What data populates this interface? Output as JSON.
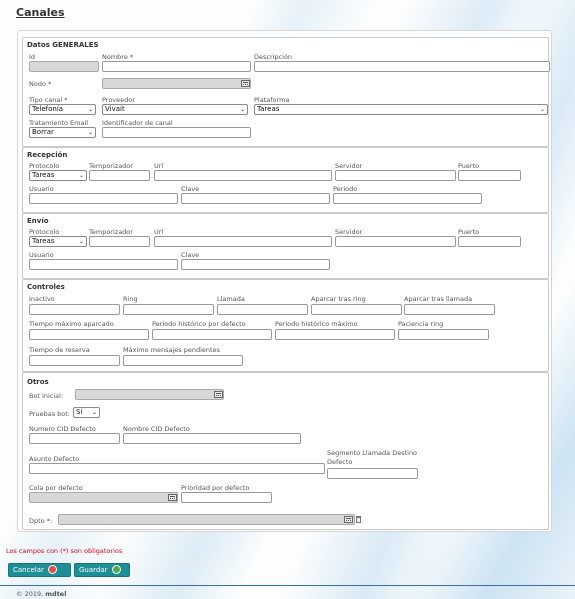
{
  "page": {
    "title": "Canales"
  },
  "generales": {
    "title": "Datos GENERALES",
    "id_label": "Id",
    "nombre_label": "Nombre *",
    "descripcion_label": "Descripción",
    "nodo_label": "Nodo *",
    "tipo_canal_label": "Tipo canal *",
    "tipo_canal_value": "Telefonía",
    "proveedor_label": "Proveedor",
    "proveedor_value": "Vivait",
    "plataforma_label": "Plataforma",
    "plataforma_value": "Tareas",
    "tratamiento_label": "Tratamiento Email",
    "tratamiento_value": "Borrar",
    "identificador_label": "Identificador de canal"
  },
  "recepcion": {
    "title": "Recepción",
    "protocolo_label": "Protocolo",
    "protocolo_value": "Tareas",
    "temporizador_label": "Temporizador",
    "url_label": "Url",
    "servidor_label": "Servidor",
    "puerto_label": "Puerto",
    "usuario_label": "Usuario",
    "clave_label": "Clave",
    "periodo_label": "Periodo"
  },
  "envio": {
    "title": "Envío",
    "protocolo_label": "Protocolo",
    "protocolo_value": "Tareas",
    "temporizador_label": "Temporizador",
    "url_label": "Url",
    "servidor_label": "Servidor",
    "puerto_label": "Puerto",
    "usuario_label": "Usuario",
    "clave_label": "Clave"
  },
  "controles": {
    "title": "Controles",
    "inactivo_label": "Inactivo",
    "ring_label": "Ring",
    "llamada_label": "Llamada",
    "aparcar_ring_label": "Aparcar tras ring",
    "aparcar_llamada_label": "Aparcar tras llamada",
    "tiempo_max_aparcado_label": "Tiempo máximo aparcado",
    "periodo_hist_defecto_label": "Periodo histórico por defecto",
    "periodo_hist_max_label": "Periodo histórico máximo",
    "paciencia_ring_label": "Paciencia ring",
    "tiempo_reserva_label": "Tiempo de reserva",
    "max_mensajes_label": "Máximo mensajes pendientes"
  },
  "otros": {
    "title": "Otros",
    "bot_inicial_label": "Bot inicial:",
    "pruebas_bot_label": "Pruebas bot:",
    "pruebas_bot_value": "Si",
    "numero_cid_label": "Numero CID Defecto",
    "nombre_cid_label": "Nombre CID Defecto",
    "asunto_label": "Asunto Defecto",
    "segmento_label_1": "Segmento Llamada Destino",
    "segmento_label_2": "Defecto",
    "cola_label": "Cola por defecto",
    "prioridad_label": "Prioridad por defecto",
    "dpto_label": "Dpto *:"
  },
  "required_note": "Los campos con (*) son obligatorios",
  "buttons": {
    "cancel": "Cancelar",
    "save": "Guardar"
  },
  "footer": {
    "copyright": "© 2019,",
    "brand": "mdtel"
  },
  "colors": {
    "accent": "#1e8f96",
    "required": "#e0001a",
    "footer_line": "#3b6ea5"
  }
}
